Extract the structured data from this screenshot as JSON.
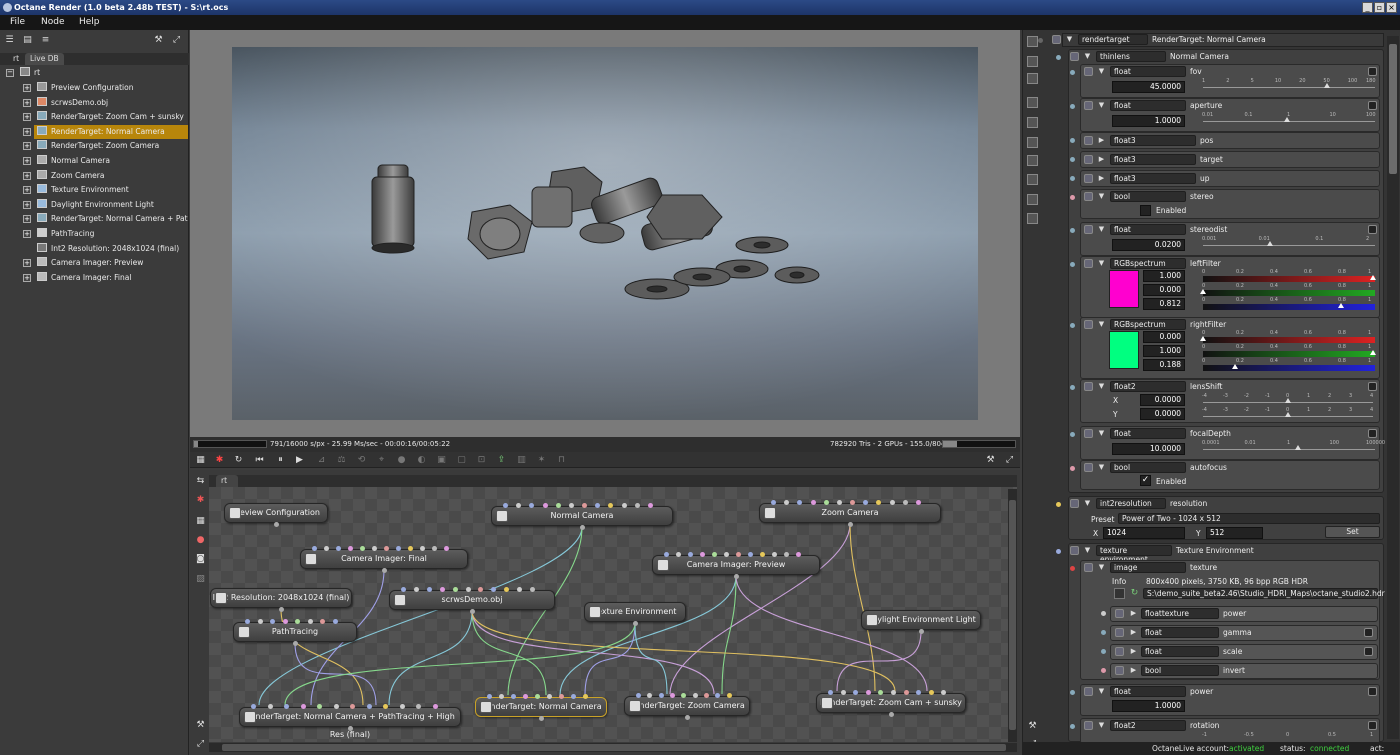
{
  "window": {
    "title": "Octane Render (1.0 beta 2.48b TEST) - S:\\rt.ocs"
  },
  "menu": [
    "File",
    "Node",
    "Help"
  ],
  "scene_tree": {
    "tabs": [
      "rt",
      "Live DB"
    ],
    "root": "rt",
    "items": [
      {
        "label": "Preview Configuration",
        "icon": "config-icon"
      },
      {
        "label": "scrwsDemo.obj",
        "icon": "mesh-icon"
      },
      {
        "label": "RenderTarget: Zoom Cam + sunsky",
        "icon": "render-target-icon"
      },
      {
        "label": "RenderTarget: Normal Camera",
        "icon": "render-target-icon",
        "selected": true
      },
      {
        "label": "RenderTarget: Zoom Camera",
        "icon": "render-target-icon"
      },
      {
        "label": "Normal Camera",
        "icon": "camera-icon"
      },
      {
        "label": "Zoom Camera",
        "icon": "camera-icon"
      },
      {
        "label": "Texture Environment",
        "icon": "environment-icon"
      },
      {
        "label": "Daylight Environment Light",
        "icon": "environment-icon"
      },
      {
        "label": "RenderTarget: Normal Camera + PathT",
        "icon": "render-target-icon"
      },
      {
        "label": "PathTracing",
        "icon": "kernel-icon"
      },
      {
        "label": "Int2 Resolution: 2048x1024 (final)",
        "icon": "resolution-icon"
      },
      {
        "label": "Camera Imager: Preview",
        "icon": "imager-icon"
      },
      {
        "label": "Camera Imager: Final",
        "icon": "imager-icon"
      }
    ]
  },
  "render_status": {
    "left": "791/16000 s/px - 25.99 Ms/sec - 00:00:16/00:05:22",
    "right": "782920 Tris - 2 GPUs - 155.0/804 MB",
    "progress": 0.05
  },
  "graph": {
    "tab": "rt",
    "nodes": [
      {
        "id": "preview-config",
        "label": "Preview Configuration"
      },
      {
        "id": "normal-camera",
        "label": "Normal Camera"
      },
      {
        "id": "zoom-camera",
        "label": "Zoom Camera"
      },
      {
        "id": "imager-final",
        "label": "Camera Imager: Final"
      },
      {
        "id": "imager-preview",
        "label": "Camera Imager: Preview"
      },
      {
        "id": "int2-res",
        "label": "Int2 Resolution: 2048x1024 (final)"
      },
      {
        "id": "scrws-obj",
        "label": "scrwsDemo.obj"
      },
      {
        "id": "texture-env",
        "label": "Texture Environment"
      },
      {
        "id": "daylight",
        "label": "Daylight Environment Light"
      },
      {
        "id": "pathtracing",
        "label": "PathTracing"
      },
      {
        "id": "rt-normal-pt",
        "label": "RenderTarget: Normal Camera + PathTracing + High Res (final)"
      },
      {
        "id": "rt-normal",
        "label": "RenderTarget: Normal Camera",
        "selected": true
      },
      {
        "id": "rt-zoom",
        "label": "RenderTarget: Zoom Camera"
      },
      {
        "id": "rt-zoom-sunsky",
        "label": "RenderTarget: Zoom Cam + sunsky"
      }
    ],
    "wires": [
      [
        "normal-camera",
        "rt-normal-pt"
      ],
      [
        "normal-camera",
        "rt-normal"
      ],
      [
        "zoom-camera",
        "rt-zoom"
      ],
      [
        "zoom-camera",
        "rt-zoom-sunsky"
      ],
      [
        "imager-final",
        "rt-normal-pt"
      ],
      [
        "imager-preview",
        "rt-normal"
      ],
      [
        "imager-preview",
        "rt-zoom"
      ],
      [
        "imager-preview",
        "rt-zoom-sunsky"
      ],
      [
        "int2-res",
        "rt-normal-pt"
      ],
      [
        "pathtracing",
        "rt-normal-pt"
      ],
      [
        "scrws-obj",
        "rt-normal-pt"
      ],
      [
        "scrws-obj",
        "rt-normal"
      ],
      [
        "scrws-obj",
        "rt-zoom"
      ],
      [
        "scrws-obj",
        "rt-zoom-sunsky"
      ],
      [
        "texture-env",
        "rt-normal"
      ],
      [
        "texture-env",
        "rt-zoom"
      ],
      [
        "texture-env",
        "rt-normal-pt"
      ],
      [
        "daylight",
        "rt-zoom-sunsky"
      ]
    ],
    "wire_colors": [
      "#86c8d8",
      "#86d88c",
      "#c8a0d8",
      "#e0c060",
      "#a0a0e8"
    ]
  },
  "props": {
    "header": {
      "type": "rendertarget",
      "name": "RenderTarget: Normal Camera"
    },
    "camera": {
      "type": "thinlens",
      "name": "Normal Camera"
    },
    "fov": {
      "type": "float",
      "name": "fov",
      "value": "45.0000",
      "ticks": [
        "1",
        "2",
        "5",
        "10",
        "20",
        "50",
        "100",
        "180"
      ]
    },
    "aperture": {
      "type": "float",
      "name": "aperture",
      "value": "1.0000",
      "ticks": [
        "0.01",
        "0.1",
        "1",
        "10",
        "100"
      ]
    },
    "pos": {
      "type": "float3",
      "name": "pos"
    },
    "target": {
      "type": "float3",
      "name": "target"
    },
    "up": {
      "type": "float3",
      "name": "up"
    },
    "stereo": {
      "type": "bool",
      "name": "stereo",
      "check_label": "Enabled",
      "checked": false
    },
    "stereodist": {
      "type": "float",
      "name": "stereodist",
      "value": "0.0200",
      "ticks": [
        "0.001",
        "0.01",
        "0.1",
        "2"
      ]
    },
    "leftFilter": {
      "type": "RGBspectrum",
      "name": "leftFilter",
      "r": "1.000",
      "g": "0.000",
      "b": "0.812",
      "swatch": "#ff00cf"
    },
    "rightFilter": {
      "type": "RGBspectrum",
      "name": "rightFilter",
      "r": "0.000",
      "g": "1.000",
      "b": "0.188",
      "swatch": "#00ff80"
    },
    "rgb_ticks": [
      "0",
      "0.2",
      "0.4",
      "0.6",
      "0.8",
      "1"
    ],
    "lensShift": {
      "type": "float2",
      "name": "lensShift",
      "x_label": "X",
      "y_label": "Y",
      "x": "0.0000",
      "y": "0.0000",
      "ticks": [
        "-4",
        "-3",
        "-2",
        "-1",
        "0",
        "1",
        "2",
        "3",
        "4"
      ]
    },
    "focalDepth": {
      "type": "float",
      "name": "focalDepth",
      "value": "10.0000",
      "ticks": [
        "0.0001",
        "0.01",
        "1",
        "100",
        "100000"
      ]
    },
    "autofocus": {
      "type": "bool",
      "name": "autofocus",
      "check_label": "Enabled",
      "checked": true
    },
    "resolution": {
      "type": "int2resolution",
      "name": "resolution",
      "preset_label": "Preset",
      "preset": "Power of Two - 1024 x 512",
      "x_label": "X",
      "x": "1024",
      "y_label": "Y",
      "y": "512",
      "set_label": "Set"
    },
    "environment": {
      "type": "texture environment",
      "name": "Texture Environment"
    },
    "texture": {
      "type": "image",
      "name": "texture",
      "info_label": "Info",
      "info": "800x400 pixels, 3750 KB, 96 bpp RGB HDR",
      "path": "S:\\demo_suite_beta2.46\\Studio_HDRI_Maps\\octane_studio2.hdr"
    },
    "power_tex": {
      "type": "floattexture",
      "name": "power"
    },
    "gamma": {
      "type": "float",
      "name": "gamma"
    },
    "scale": {
      "type": "float",
      "name": "scale"
    },
    "invert": {
      "type": "bool",
      "name": "invert"
    },
    "power": {
      "type": "float",
      "name": "power",
      "value": "1.0000"
    },
    "rotation": {
      "type": "float2",
      "name": "rotation",
      "ticks": [
        "-1",
        "-0.5",
        "0",
        "0.5",
        "1"
      ]
    }
  },
  "statusbar": {
    "account_label": "OctaneLive account:",
    "account_value": "activated",
    "status_label": "status:",
    "status_value": "connected",
    "act_label": "act:"
  }
}
